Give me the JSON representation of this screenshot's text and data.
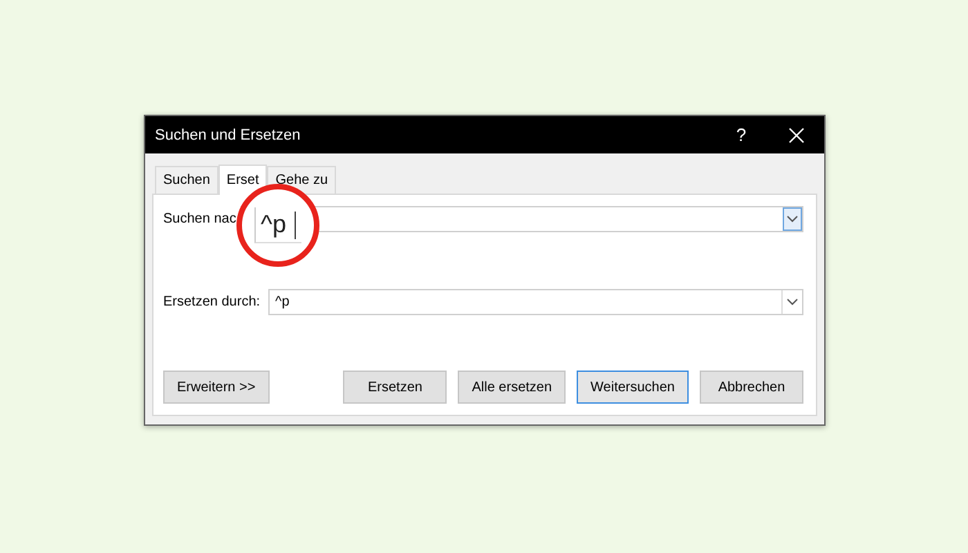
{
  "window": {
    "title": "Suchen und Ersetzen"
  },
  "title_buttons": [
    {
      "kind": "help",
      "label": "?"
    },
    {
      "kind": "close"
    }
  ],
  "tabs": [
    {
      "label": "Suchen",
      "selected": false
    },
    {
      "label": "Erset",
      "selected": true
    },
    {
      "label": "Gehe zu",
      "selected": false
    }
  ],
  "find": {
    "label": "Suchen nac",
    "focused_dropdown": true
  },
  "magnifier": {
    "text": "^p"
  },
  "replace": {
    "label": "Ersetzen durch:",
    "value": "^p",
    "focused_dropdown": false
  },
  "buttons": [
    {
      "label": "Erweitern >>",
      "default": false
    },
    {
      "label": "Ersetzen",
      "default": false
    },
    {
      "label": "Alle ersetzen",
      "default": false
    },
    {
      "label": "Weitersuchen",
      "default": true
    },
    {
      "label": "Abbrechen",
      "default": false
    }
  ]
}
